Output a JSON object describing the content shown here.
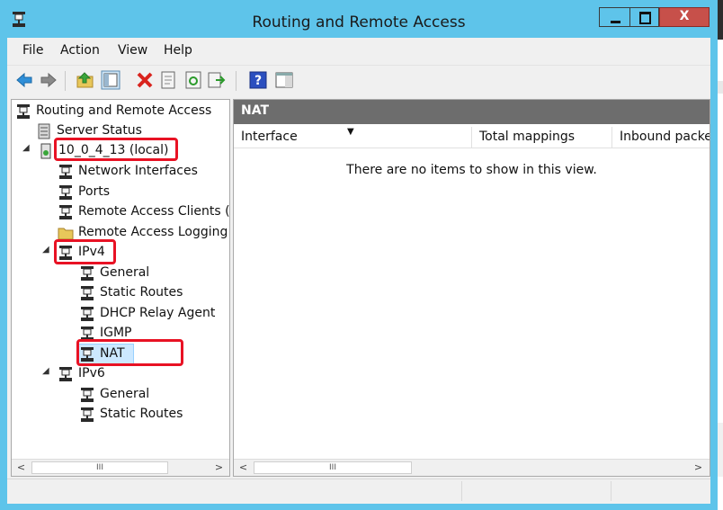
{
  "window": {
    "title": "Routing and Remote Access",
    "close_glyph": "X"
  },
  "menu": [
    "File",
    "Action",
    "View",
    "Help"
  ],
  "toolbar_icons": [
    "back-arrow-icon",
    "forward-arrow-icon",
    "up-folder-icon",
    "show-hide-tree-icon",
    "delete-icon",
    "properties-icon",
    "refresh-icon",
    "export-list-icon",
    "help-icon",
    "action-pane-icon"
  ],
  "tree": {
    "root": "Routing and Remote Access",
    "server_status": "Server Status",
    "server": "10_0_4_13 (local)",
    "network_interfaces": "Network Interfaces",
    "ports": "Ports",
    "remote_access_clients": "Remote Access Clients (",
    "remote_access_logging": "Remote Access Logging",
    "ipv4": "IPv4",
    "ipv4_general": "General",
    "ipv4_static_routes": "Static Routes",
    "ipv4_dhcp_relay": "DHCP Relay Agent",
    "ipv4_igmp": "IGMP",
    "ipv4_nat": "NAT",
    "ipv6": "IPv6",
    "ipv6_general": "General",
    "ipv6_static_routes": "Static Routes",
    "expanded_glyph": "◢"
  },
  "details": {
    "header": "NAT",
    "columns": [
      "Interface",
      "Total mappings",
      "Inbound packe"
    ],
    "sort_indicator": "▼",
    "empty_message": "There are no items to show in this view."
  },
  "scrollbar": {
    "left": "<",
    "right": ">",
    "thumb": "III"
  },
  "colors": {
    "title_bar": "#5ec4ea",
    "highlight_box": "#e81224",
    "close_button": "#c7504a",
    "selection": "#cce8ff",
    "pane_header": "#6d6d6d"
  }
}
